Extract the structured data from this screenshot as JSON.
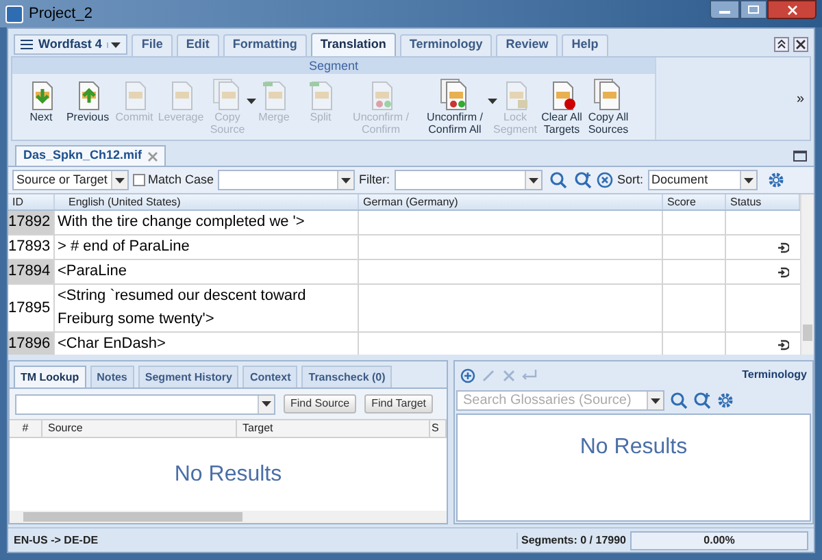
{
  "window": {
    "title": "Project_2"
  },
  "menu": {
    "app_label": "Wordfast 4",
    "tabs": [
      {
        "label": "File",
        "selected": false
      },
      {
        "label": "Edit",
        "selected": false
      },
      {
        "label": "Formatting",
        "selected": false
      },
      {
        "label": "Translation",
        "selected": true
      },
      {
        "label": "Terminology",
        "selected": false
      },
      {
        "label": "Review",
        "selected": false
      },
      {
        "label": "Help",
        "selected": false
      }
    ]
  },
  "ribbon": {
    "group": "Segment",
    "overflow": "»",
    "buttons": [
      {
        "label": "Next",
        "disabled": false,
        "dropdown": false
      },
      {
        "label": "Previous",
        "disabled": false,
        "dropdown": false
      },
      {
        "label": "Commit",
        "disabled": true,
        "dropdown": false
      },
      {
        "label": "Leverage",
        "disabled": true,
        "dropdown": false
      },
      {
        "label": "Copy Source",
        "disabled": true,
        "dropdown": true
      },
      {
        "label": "Merge",
        "disabled": true,
        "dropdown": false
      },
      {
        "label": "Split",
        "disabled": true,
        "dropdown": false
      },
      {
        "label": "Unconfirm / Confirm",
        "disabled": true,
        "dropdown": false
      },
      {
        "label": "Unconfirm / Confirm All",
        "disabled": false,
        "dropdown": true
      },
      {
        "label": "Lock Segment",
        "disabled": true,
        "dropdown": false
      },
      {
        "label": "Clear All Targets",
        "disabled": false,
        "dropdown": false
      },
      {
        "label": "Copy All Sources",
        "disabled": false,
        "dropdown": false
      }
    ]
  },
  "document_tab": {
    "label": "Das_Spkn_Ch12.mif"
  },
  "filter_bar": {
    "scope": "Source or Target",
    "match_case": {
      "label": "Match Case",
      "checked": false
    },
    "filter_label": "Filter:",
    "sort_label": "Sort:",
    "sort_value": "Document"
  },
  "grid": {
    "columns": [
      "ID",
      "English (United States)",
      "German (Germany)",
      "Score",
      "Status"
    ],
    "rows": [
      {
        "id": "17892",
        "source": "With the tire change completed we '>",
        "status_icon": false
      },
      {
        "id": "17893",
        "source": "> # end of ParaLine",
        "status_icon": true
      },
      {
        "id": "17894",
        "source": "<ParaLine",
        "status_icon": true
      },
      {
        "id": "17895",
        "source": "<String `resumed our descent toward Freiburg some twenty'>",
        "status_icon": false
      },
      {
        "id": "17896",
        "source": "<Char EnDash>",
        "status_icon": true
      }
    ]
  },
  "lower_tabs": [
    {
      "label": "TM Lookup",
      "selected": true
    },
    {
      "label": "Notes",
      "selected": false
    },
    {
      "label": "Segment History",
      "selected": false
    },
    {
      "label": "Context",
      "selected": false
    },
    {
      "label": "Transcheck (0)",
      "selected": false
    }
  ],
  "tm_lookup": {
    "buttons": [
      "Find Source",
      "Find Target"
    ],
    "columns": [
      "#",
      "Source",
      "Target",
      "S"
    ],
    "empty": "No Results"
  },
  "terminology": {
    "title": "Terminology",
    "placeholder": "Search Glossaries (Source)",
    "empty": "No Results"
  },
  "status_bar": {
    "languages": "EN-US -> DE-DE",
    "segments": "Segments: 0 / 17990",
    "progress": "0.00%",
    "level": 0
  }
}
